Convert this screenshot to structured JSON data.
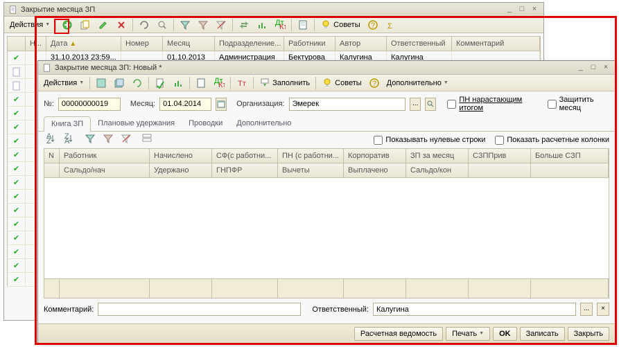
{
  "parent": {
    "title": "Закрытие месяца ЗП",
    "toolbar": {
      "actions": "Действия",
      "tips": "Советы"
    },
    "columns": {
      "num": "Н...",
      "date": "Дата",
      "number": "Номер",
      "month": "Месяц",
      "division": "Подразделение...",
      "workers": "Работники",
      "author": "Автор",
      "responsible": "Ответственный",
      "comment": "Комментарий"
    },
    "row0": {
      "date": "31.10.2013 23:59...",
      "month": "01.10.2013",
      "division": "Администрация",
      "workers": "Бектурова А...",
      "author": "Калугина",
      "responsible": "Калугина"
    }
  },
  "child": {
    "title": "Закрытие месяца ЗП: Новый *",
    "toolbar": {
      "actions": "Действия",
      "fill": "Заполнить",
      "tips": "Советы",
      "more": "Дополнительно"
    },
    "form": {
      "num_label": "№:",
      "num_value": "00000000019",
      "month_label": "Месяц:",
      "month_value": "01.04.2014",
      "org_label": "Организация:",
      "org_value": "Эмерек",
      "pn_cumulative": "ПН нарастающим итогом",
      "protect_month": "Защитить месяц"
    },
    "tabs": {
      "book": "Книга ЗП",
      "plan": "Плановые удержания",
      "postings": "Проводки",
      "extra": "Дополнительно"
    },
    "table_opts": {
      "show_zero": "Показывать нулевые строки",
      "show_calc": "Показать расчетные колонки"
    },
    "table": {
      "r1": {
        "n": "N",
        "worker": "Работник",
        "accrued": "Начислено",
        "sf": "СФ(с работни...",
        "pn": "ПН (с работни...",
        "corp": "Корпоратив",
        "zp": "ЗП за месяц",
        "szpp": "СЗППрив",
        "more": "Больше СЗП"
      },
      "r2": {
        "worker": "Сальдо/нач",
        "accrued": "Удержано",
        "sf": "ГНПФР",
        "pn": "Вычеты",
        "corp": "Выплачено",
        "zp": "Сальдо/кон"
      }
    },
    "bottom": {
      "comment_label": "Комментарий:",
      "responsible_label": "Ответственный:",
      "responsible_value": "Калугина"
    },
    "footer": {
      "calc_sheet": "Расчетная ведомость",
      "print": "Печать",
      "ok": "OK",
      "save": "Записать",
      "close": "Закрыть"
    }
  }
}
